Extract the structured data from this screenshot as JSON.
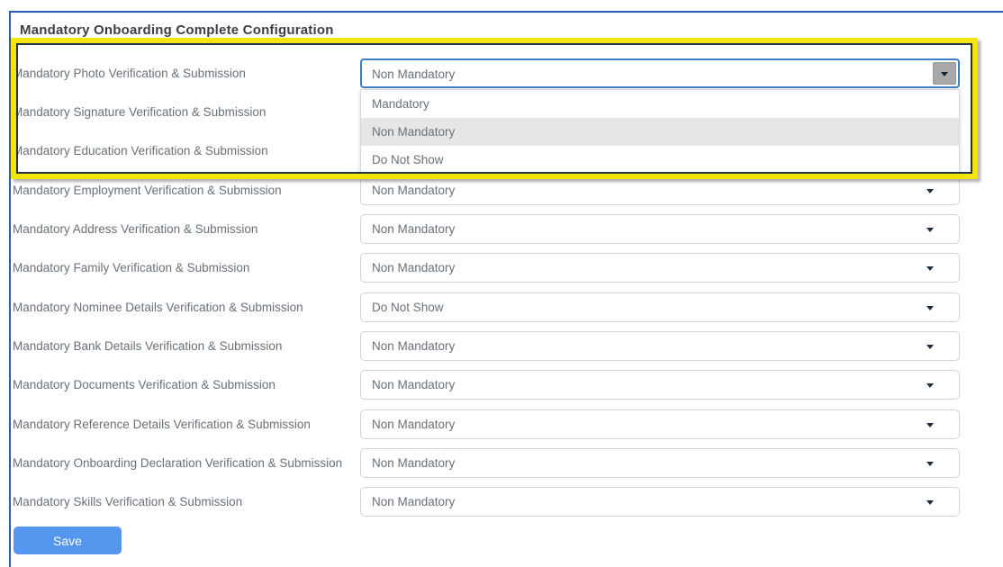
{
  "header": {
    "title": "Mandatory Onboarding Complete Configuration"
  },
  "rows": [
    {
      "label": "Mandatory Photo Verification & Submission",
      "value": "Non Mandatory",
      "state": "open"
    },
    {
      "label": "Mandatory Signature Verification & Submission",
      "value": null,
      "state": "select-hidden-behind-menu"
    },
    {
      "label": "Mandatory Education Verification & Submission",
      "value": null,
      "state": "select-hidden-behind-menu"
    },
    {
      "label": "Mandatory Employment Verification & Submission",
      "value": "Non Mandatory",
      "state": "closed"
    },
    {
      "label": "Mandatory Address Verification & Submission",
      "value": "Non Mandatory",
      "state": "closed"
    },
    {
      "label": "Mandatory Family Verification & Submission",
      "value": "Non Mandatory",
      "state": "closed"
    },
    {
      "label": "Mandatory Nominee Details Verification & Submission",
      "value": "Do Not Show",
      "state": "closed"
    },
    {
      "label": "Mandatory Bank Details Verification & Submission",
      "value": "Non Mandatory",
      "state": "closed"
    },
    {
      "label": "Mandatory Documents Verification & Submission",
      "value": "Non Mandatory",
      "state": "closed"
    },
    {
      "label": "Mandatory Reference Details Verification & Submission",
      "value": "Non Mandatory",
      "state": "closed"
    },
    {
      "label": "Mandatory Onboarding Declaration Verification & Submission",
      "value": "Non Mandatory",
      "state": "closed"
    },
    {
      "label": "Mandatory Skills Verification & Submission",
      "value": "Non Mandatory",
      "state": "closed"
    }
  ],
  "dropdown": {
    "options": [
      "Mandatory",
      "Non Mandatory",
      "Do Not Show"
    ],
    "highlighted_option": "Non Mandatory"
  },
  "buttons": {
    "save": "Save"
  },
  "colors": {
    "panel_border_blue": "#2d5cb5",
    "highlight_yellow": "#f1e50c",
    "highlight_inner_navy": "#243447",
    "focus_blue": "#3d7ec9",
    "save_button_blue": "#5596ef",
    "option_highlight_bg": "#e6e6e6",
    "text_gray": "#68717a"
  }
}
